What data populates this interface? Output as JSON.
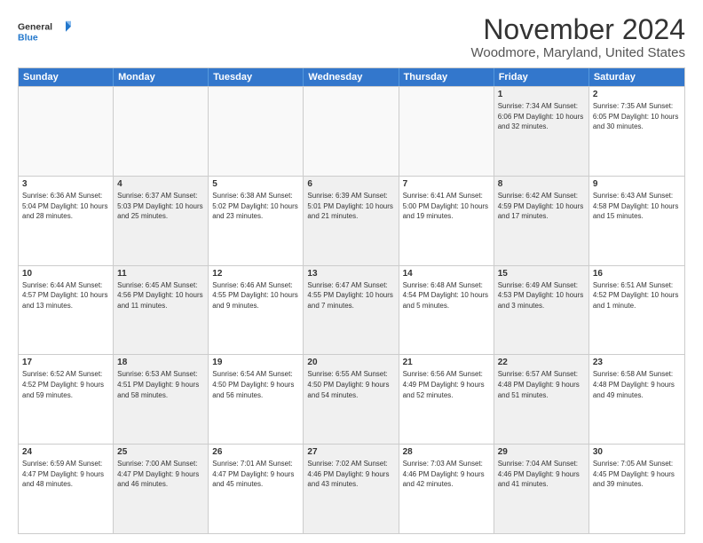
{
  "logo": {
    "line1": "General",
    "line2": "Blue"
  },
  "title": "November 2024",
  "subtitle": "Woodmore, Maryland, United States",
  "header_days": [
    "Sunday",
    "Monday",
    "Tuesday",
    "Wednesday",
    "Thursday",
    "Friday",
    "Saturday"
  ],
  "weeks": [
    [
      {
        "day": "",
        "info": "",
        "shaded": false,
        "empty": true
      },
      {
        "day": "",
        "info": "",
        "shaded": false,
        "empty": true
      },
      {
        "day": "",
        "info": "",
        "shaded": false,
        "empty": true
      },
      {
        "day": "",
        "info": "",
        "shaded": false,
        "empty": true
      },
      {
        "day": "",
        "info": "",
        "shaded": false,
        "empty": true
      },
      {
        "day": "1",
        "info": "Sunrise: 7:34 AM\nSunset: 6:06 PM\nDaylight: 10 hours\nand 32 minutes.",
        "shaded": true,
        "empty": false
      },
      {
        "day": "2",
        "info": "Sunrise: 7:35 AM\nSunset: 6:05 PM\nDaylight: 10 hours\nand 30 minutes.",
        "shaded": false,
        "empty": false
      }
    ],
    [
      {
        "day": "3",
        "info": "Sunrise: 6:36 AM\nSunset: 5:04 PM\nDaylight: 10 hours\nand 28 minutes.",
        "shaded": false,
        "empty": false
      },
      {
        "day": "4",
        "info": "Sunrise: 6:37 AM\nSunset: 5:03 PM\nDaylight: 10 hours\nand 25 minutes.",
        "shaded": true,
        "empty": false
      },
      {
        "day": "5",
        "info": "Sunrise: 6:38 AM\nSunset: 5:02 PM\nDaylight: 10 hours\nand 23 minutes.",
        "shaded": false,
        "empty": false
      },
      {
        "day": "6",
        "info": "Sunrise: 6:39 AM\nSunset: 5:01 PM\nDaylight: 10 hours\nand 21 minutes.",
        "shaded": true,
        "empty": false
      },
      {
        "day": "7",
        "info": "Sunrise: 6:41 AM\nSunset: 5:00 PM\nDaylight: 10 hours\nand 19 minutes.",
        "shaded": false,
        "empty": false
      },
      {
        "day": "8",
        "info": "Sunrise: 6:42 AM\nSunset: 4:59 PM\nDaylight: 10 hours\nand 17 minutes.",
        "shaded": true,
        "empty": false
      },
      {
        "day": "9",
        "info": "Sunrise: 6:43 AM\nSunset: 4:58 PM\nDaylight: 10 hours\nand 15 minutes.",
        "shaded": false,
        "empty": false
      }
    ],
    [
      {
        "day": "10",
        "info": "Sunrise: 6:44 AM\nSunset: 4:57 PM\nDaylight: 10 hours\nand 13 minutes.",
        "shaded": false,
        "empty": false
      },
      {
        "day": "11",
        "info": "Sunrise: 6:45 AM\nSunset: 4:56 PM\nDaylight: 10 hours\nand 11 minutes.",
        "shaded": true,
        "empty": false
      },
      {
        "day": "12",
        "info": "Sunrise: 6:46 AM\nSunset: 4:55 PM\nDaylight: 10 hours\nand 9 minutes.",
        "shaded": false,
        "empty": false
      },
      {
        "day": "13",
        "info": "Sunrise: 6:47 AM\nSunset: 4:55 PM\nDaylight: 10 hours\nand 7 minutes.",
        "shaded": true,
        "empty": false
      },
      {
        "day": "14",
        "info": "Sunrise: 6:48 AM\nSunset: 4:54 PM\nDaylight: 10 hours\nand 5 minutes.",
        "shaded": false,
        "empty": false
      },
      {
        "day": "15",
        "info": "Sunrise: 6:49 AM\nSunset: 4:53 PM\nDaylight: 10 hours\nand 3 minutes.",
        "shaded": true,
        "empty": false
      },
      {
        "day": "16",
        "info": "Sunrise: 6:51 AM\nSunset: 4:52 PM\nDaylight: 10 hours\nand 1 minute.",
        "shaded": false,
        "empty": false
      }
    ],
    [
      {
        "day": "17",
        "info": "Sunrise: 6:52 AM\nSunset: 4:52 PM\nDaylight: 9 hours\nand 59 minutes.",
        "shaded": false,
        "empty": false
      },
      {
        "day": "18",
        "info": "Sunrise: 6:53 AM\nSunset: 4:51 PM\nDaylight: 9 hours\nand 58 minutes.",
        "shaded": true,
        "empty": false
      },
      {
        "day": "19",
        "info": "Sunrise: 6:54 AM\nSunset: 4:50 PM\nDaylight: 9 hours\nand 56 minutes.",
        "shaded": false,
        "empty": false
      },
      {
        "day": "20",
        "info": "Sunrise: 6:55 AM\nSunset: 4:50 PM\nDaylight: 9 hours\nand 54 minutes.",
        "shaded": true,
        "empty": false
      },
      {
        "day": "21",
        "info": "Sunrise: 6:56 AM\nSunset: 4:49 PM\nDaylight: 9 hours\nand 52 minutes.",
        "shaded": false,
        "empty": false
      },
      {
        "day": "22",
        "info": "Sunrise: 6:57 AM\nSunset: 4:48 PM\nDaylight: 9 hours\nand 51 minutes.",
        "shaded": true,
        "empty": false
      },
      {
        "day": "23",
        "info": "Sunrise: 6:58 AM\nSunset: 4:48 PM\nDaylight: 9 hours\nand 49 minutes.",
        "shaded": false,
        "empty": false
      }
    ],
    [
      {
        "day": "24",
        "info": "Sunrise: 6:59 AM\nSunset: 4:47 PM\nDaylight: 9 hours\nand 48 minutes.",
        "shaded": false,
        "empty": false
      },
      {
        "day": "25",
        "info": "Sunrise: 7:00 AM\nSunset: 4:47 PM\nDaylight: 9 hours\nand 46 minutes.",
        "shaded": true,
        "empty": false
      },
      {
        "day": "26",
        "info": "Sunrise: 7:01 AM\nSunset: 4:47 PM\nDaylight: 9 hours\nand 45 minutes.",
        "shaded": false,
        "empty": false
      },
      {
        "day": "27",
        "info": "Sunrise: 7:02 AM\nSunset: 4:46 PM\nDaylight: 9 hours\nand 43 minutes.",
        "shaded": true,
        "empty": false
      },
      {
        "day": "28",
        "info": "Sunrise: 7:03 AM\nSunset: 4:46 PM\nDaylight: 9 hours\nand 42 minutes.",
        "shaded": false,
        "empty": false
      },
      {
        "day": "29",
        "info": "Sunrise: 7:04 AM\nSunset: 4:46 PM\nDaylight: 9 hours\nand 41 minutes.",
        "shaded": true,
        "empty": false
      },
      {
        "day": "30",
        "info": "Sunrise: 7:05 AM\nSunset: 4:45 PM\nDaylight: 9 hours\nand 39 minutes.",
        "shaded": false,
        "empty": false
      }
    ]
  ]
}
